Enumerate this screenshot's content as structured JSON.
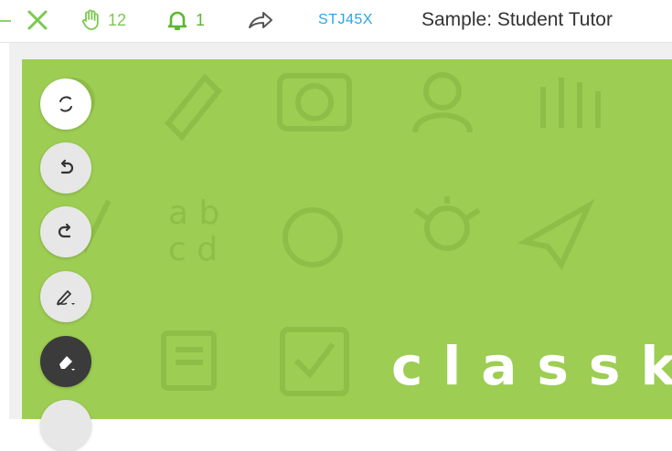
{
  "toolbar": {
    "hand_count": "12",
    "notification_count": "1",
    "class_code": "STJ45X",
    "lesson_title": "Sample: Student Tutor"
  },
  "slide": {
    "logo_text": "classk",
    "background_color": "#9dcd52"
  },
  "tools": [
    "refresh-icon",
    "undo-icon",
    "redo-icon",
    "pen-icon",
    "eraser-icon",
    "more-tool"
  ],
  "colors": {
    "accent_green": "#7bc94f",
    "code_blue": "#2aa6e6"
  }
}
